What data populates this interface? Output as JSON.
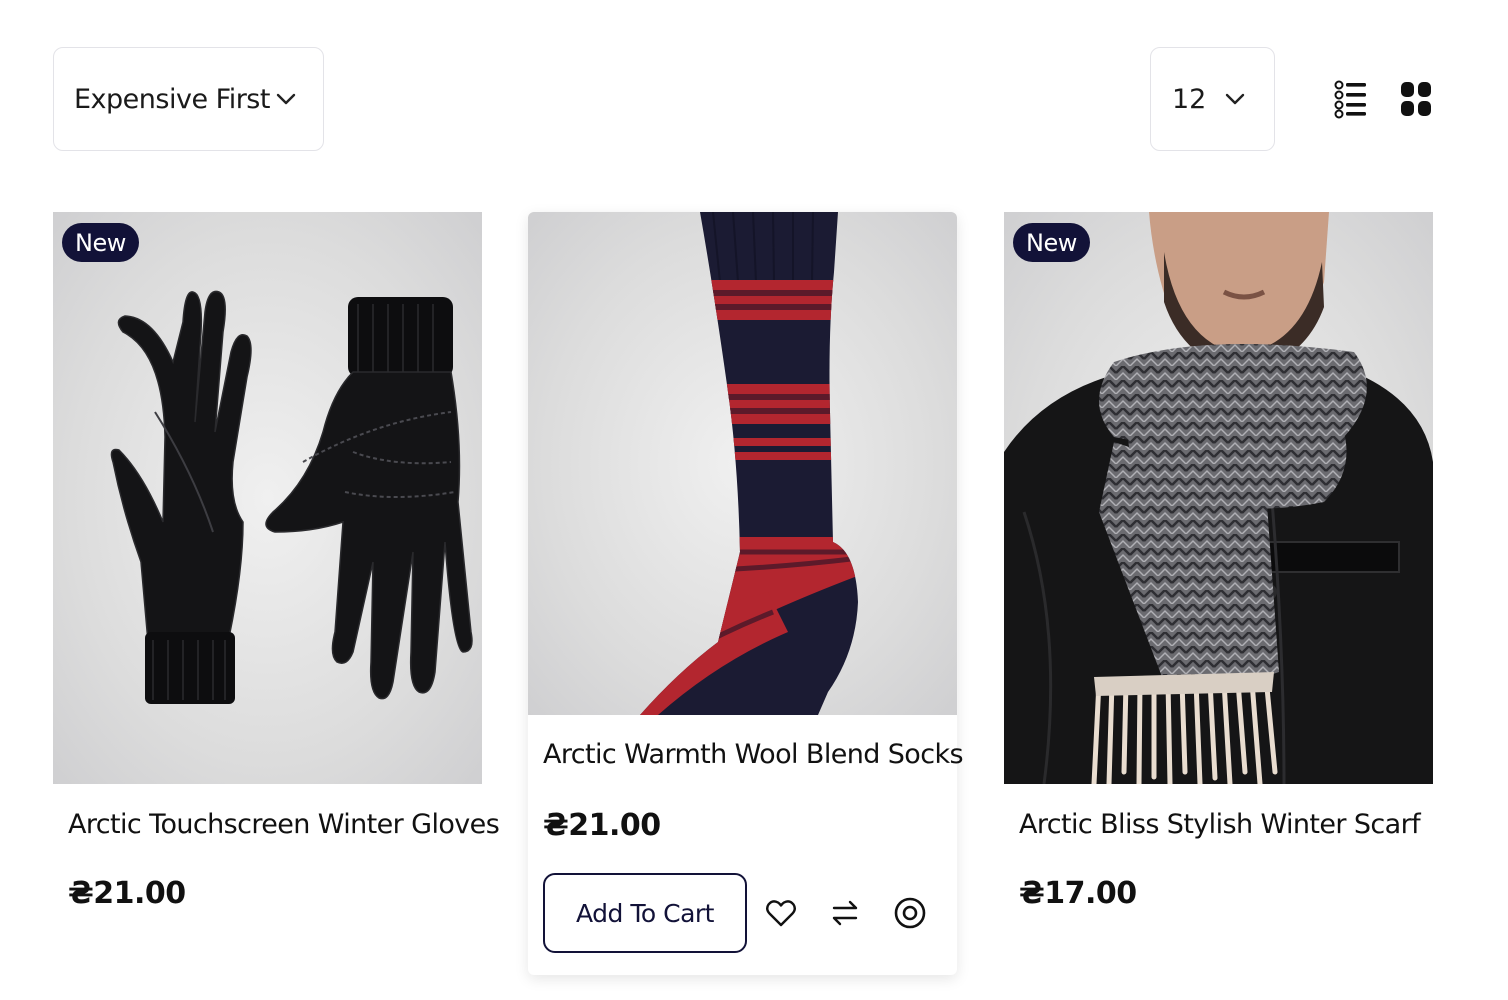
{
  "toolbar": {
    "sort_label": "Expensive First",
    "per_page": "12",
    "sort_icon": "chevron-down-icon",
    "list_view_icon": "list-view-icon",
    "grid_view_icon": "grid-view-icon"
  },
  "products": [
    {
      "badge": "New",
      "title": "Arctic Touchscreen Winter Gloves",
      "price": "₴21.00",
      "image": "black leather gloves"
    },
    {
      "title": "Arctic Warmth Wool Blend Socks",
      "price": "₴21.00",
      "image": "navy and red wool sock",
      "add_to_cart": "Add To Cart",
      "actions": [
        "heart-icon",
        "compare-icon",
        "quick-view-icon"
      ]
    },
    {
      "badge": "New",
      "title": "Arctic Bliss Stylish Winter Scarf",
      "price": "₴17.00",
      "image": "man wearing grey herringbone scarf"
    }
  ],
  "colors": {
    "brand_dark": "#121238",
    "border": "#e3e3e8",
    "sock_red": "#b3262f",
    "sock_navy": "#1b1b33"
  }
}
